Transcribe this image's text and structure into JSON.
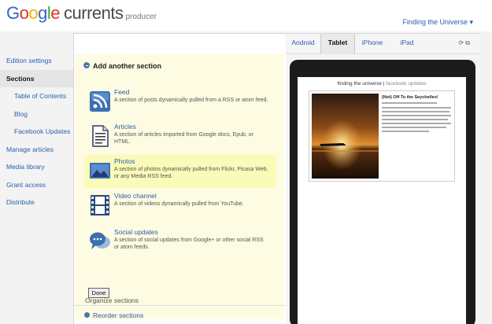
{
  "header": {
    "logo_google": [
      "G",
      "o",
      "o",
      "g",
      "l",
      "e"
    ],
    "logo_currents": "currents",
    "logo_producer": "producer",
    "edition_select": "Finding the Universe ▾"
  },
  "nav": {
    "items": [
      {
        "label": "Edition settings"
      },
      {
        "label": "Sections"
      },
      {
        "label": "Table of Contents"
      },
      {
        "label": "Blog"
      },
      {
        "label": "Facebook Updates"
      },
      {
        "label": "Manage articles"
      },
      {
        "label": "Media library"
      },
      {
        "label": "Grant access"
      },
      {
        "label": "Distribute"
      }
    ]
  },
  "section": {
    "header": "Add another section",
    "options": [
      {
        "title": "Feed",
        "desc": "A section of posts dynamically pulled from a RSS or atom feed.",
        "icon": "rss-icon"
      },
      {
        "title": "Articles",
        "desc": "A section of articles imported from Google docs, Epub, or HTML.",
        "icon": "document-icon"
      },
      {
        "title": "Photos",
        "desc": "A section of photos dynamically pulled from Flickr, Picasa Web, or any Media RSS feed.",
        "icon": "photo-icon"
      },
      {
        "title": "Video channel",
        "desc": "A section of videos dynamically pulled from YouTube.",
        "icon": "film-icon"
      },
      {
        "title": "Social updates",
        "desc": "A section of social updates from Google+ or other social RSS or atom feeds.",
        "icon": "chat-bubbles-icon"
      }
    ],
    "done_button": "Done",
    "organize_label": "Organize sections",
    "reorder_label": "Reorder sections"
  },
  "preview": {
    "tabs": [
      "Android",
      "Tablet",
      "iPhone",
      "iPad"
    ],
    "active_tab": "Tablet",
    "tools": "⟳ ⧉",
    "screen_title": "finding the universe",
    "screen_subtitle": "facebook updates",
    "card_title": "(Not) Off To the Seychelles!"
  },
  "colors": {
    "link": "#2a5db0",
    "panel_bg": "#fdfbe1",
    "highlight": "#fafbb8"
  }
}
